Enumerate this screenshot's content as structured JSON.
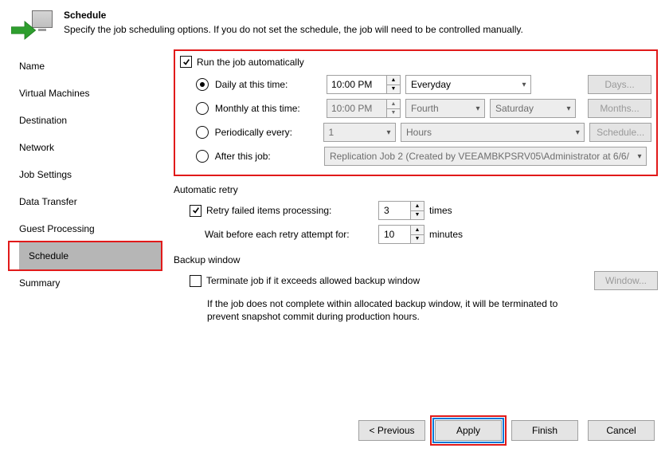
{
  "header": {
    "title": "Schedule",
    "description": "Specify the job scheduling options. If you do not set the schedule, the job will need to be controlled manually."
  },
  "sidebar": {
    "items": [
      {
        "label": "Name"
      },
      {
        "label": "Virtual Machines"
      },
      {
        "label": "Destination"
      },
      {
        "label": "Network"
      },
      {
        "label": "Job Settings"
      },
      {
        "label": "Data Transfer"
      },
      {
        "label": "Guest Processing"
      },
      {
        "label": "Schedule"
      },
      {
        "label": "Summary"
      }
    ],
    "selected_index": 7
  },
  "schedule": {
    "run_auto": {
      "label": "Run the job automatically",
      "checked": true
    },
    "daily": {
      "label": "Daily at this time:",
      "selected": true,
      "time": "10:00 PM",
      "recurrence": "Everyday",
      "button": "Days..."
    },
    "monthly": {
      "label": "Monthly at this time:",
      "selected": false,
      "time": "10:00 PM",
      "ordinal": "Fourth",
      "weekday": "Saturday",
      "button": "Months..."
    },
    "periodic": {
      "label": "Periodically every:",
      "selected": false,
      "value": "1",
      "unit": "Hours",
      "button": "Schedule..."
    },
    "after": {
      "label": "After this job:",
      "selected": false,
      "job": "Replication Job 2 (Created by VEEAMBKPSRV05\\Administrator at 6/6/"
    }
  },
  "retry": {
    "title": "Automatic retry",
    "chk_label": "Retry failed items processing:",
    "checked": true,
    "times_value": "3",
    "times_label": "times",
    "wait_label": "Wait before each retry attempt for:",
    "wait_value": "10",
    "wait_unit": "minutes"
  },
  "backup_window": {
    "title": "Backup window",
    "chk_label": "Terminate job if it exceeds allowed backup window",
    "checked": false,
    "button": "Window...",
    "help": "If the job does not complete within allocated backup window, it will be terminated to prevent snapshot commit during production hours."
  },
  "footer": {
    "previous": "< Previous",
    "apply": "Apply",
    "finish": "Finish",
    "cancel": "Cancel"
  }
}
